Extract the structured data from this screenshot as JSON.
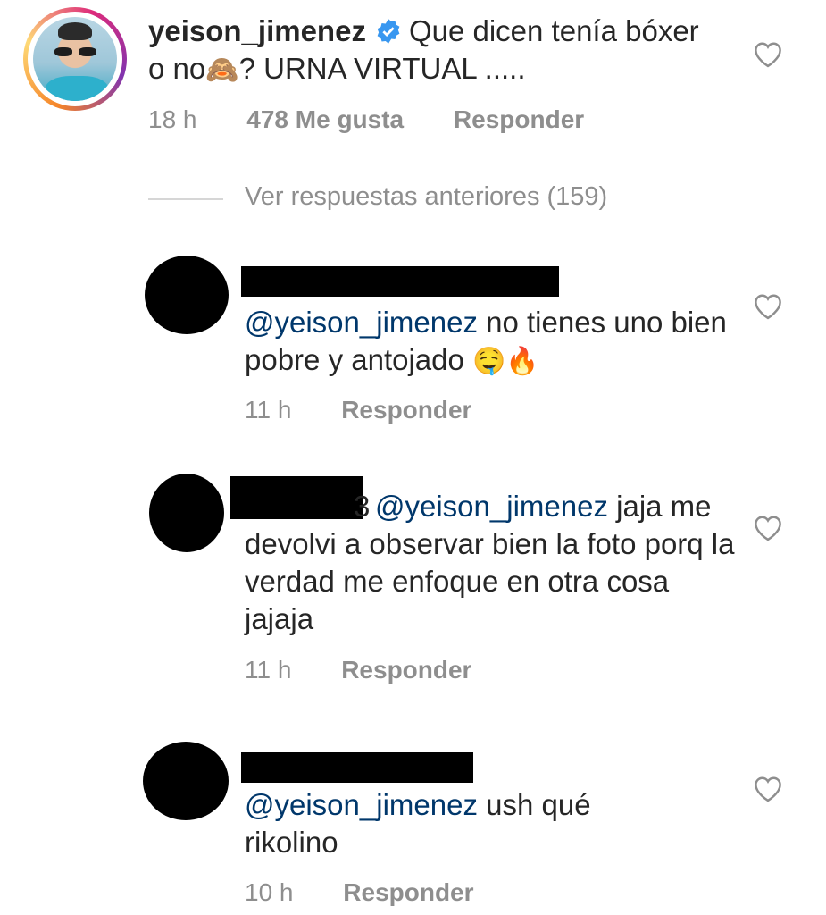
{
  "main_comment": {
    "username": "yeison_jimenez",
    "text_part1": "Que dicen tenía bóxer o no",
    "emoji": "🙈",
    "text_part2": "? URNA VIRTUAL .....",
    "time": "18 h",
    "likes": "478 Me gusta",
    "reply_label": "Responder"
  },
  "view_previous": "Ver respuestas anteriores (159)",
  "replies": [
    {
      "mention": "@yeison_jimenez",
      "text": " no tienes uno bien pobre y antojado ",
      "emojis": "🤤🔥",
      "time": "11 h",
      "reply_label": "Responder"
    },
    {
      "username_tail": "3",
      "mention": "@yeison_jimenez",
      "text": " jaja me devolvi a observar bien la foto porq la verdad me enfoque en otra cosa jajaja",
      "time": "11 h",
      "reply_label": "Responder"
    },
    {
      "mention": "@yeison_jimenez",
      "text": " ush qué rikolino",
      "time": "10 h",
      "reply_label": "Responder"
    }
  ],
  "icons": {
    "verified": "verified-badge-icon",
    "like": "heart-outline-icon"
  },
  "colors": {
    "text": "#262626",
    "muted": "#8e8e8e",
    "mention": "#00376b",
    "verified": "#3897f0"
  }
}
